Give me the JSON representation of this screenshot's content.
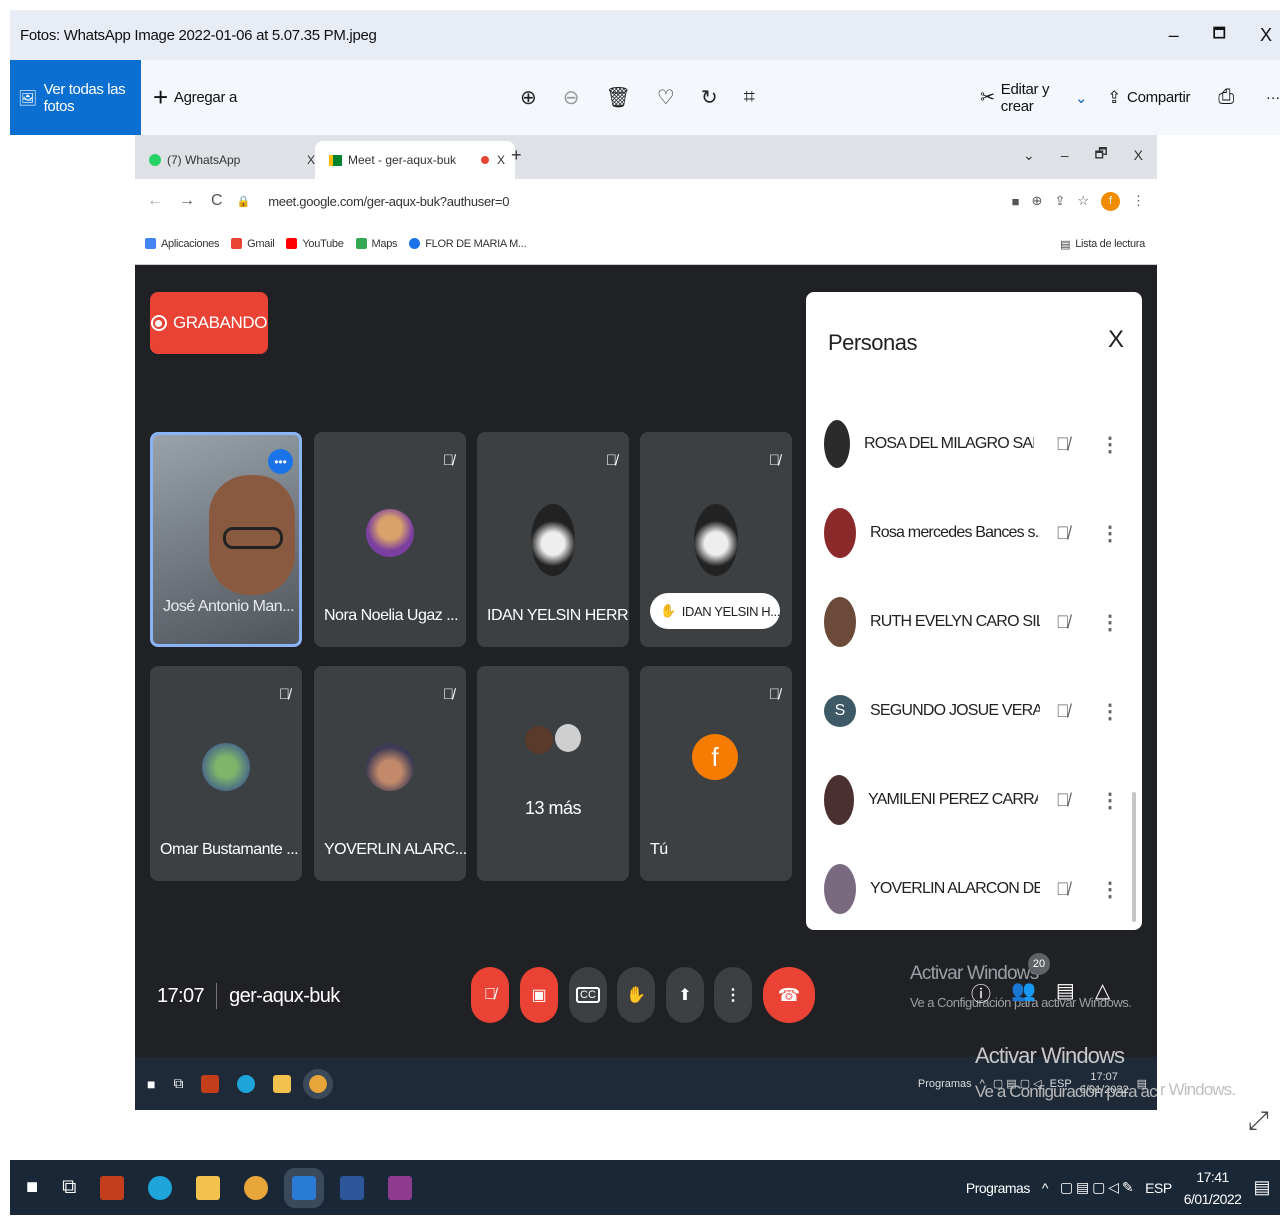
{
  "window": {
    "title": "Fotos: WhatsApp Image 2022-01-06 at 5.07.35 PM.jpeg",
    "controls": [
      "–",
      "🗖",
      "X"
    ]
  },
  "toolbar": {
    "see_all": "Ver todas las fotos",
    "add_to": "Agregar a",
    "edit_create": "Editar y crear",
    "share": "Compartir",
    "more": "···"
  },
  "browser": {
    "tabs": [
      {
        "label": "(7) WhatsApp",
        "close": "X"
      },
      {
        "label": "Meet - ger-aqux-buk",
        "close": "X"
      }
    ],
    "new_tab": "+",
    "url": "meet.google.com/ger-aqux-buk?authuser=0",
    "profile_initial": "f",
    "bookmarks": [
      {
        "label": "Aplicaciones",
        "color": "#4285f4"
      },
      {
        "label": "Gmail",
        "color": "#ea4335"
      },
      {
        "label": "YouTube",
        "color": "#ff0000"
      },
      {
        "label": "Maps",
        "color": "#34a853"
      },
      {
        "label": "FLOR DE MARIA M...",
        "color": "#1a73e8"
      }
    ],
    "reading_list": "Lista de lectura"
  },
  "meet": {
    "recording": "GRABANDO",
    "tiles": [
      {
        "name": "José Antonio Man..."
      },
      {
        "name": "Nora Noelia Ugaz ..."
      },
      {
        "name": "IDAN YELSIN HERR..."
      },
      {
        "name": "IDAN YELSIN H..."
      },
      {
        "name": "Omar Bustamante ..."
      },
      {
        "name": "YOVERLIN ALARC..."
      },
      {
        "name": "13 más"
      },
      {
        "name": "Tú",
        "initial": "f"
      }
    ],
    "time": "17:07",
    "code": "ger-aqux-buk",
    "participants_count": "20",
    "activate_title": "Activar Windows",
    "activate_sub": "Ve a Configuración para activar Windows."
  },
  "people_panel": {
    "title": "Personas",
    "close": "X",
    "people": [
      {
        "name": "ROSA DEL MILAGRO SAN...",
        "avatar_color": "#2b2b2b"
      },
      {
        "name": "Rosa mercedes Bances s...",
        "avatar_color": "#8a2a2a"
      },
      {
        "name": "RUTH EVELYN CARO SILVA",
        "avatar_color": "#6b4a3a"
      },
      {
        "name": "SEGUNDO JOSUE VERA I...",
        "avatar_color": "#3d5a66",
        "initial": "S"
      },
      {
        "name": "YAMILENI PEREZ CARRAS...",
        "avatar_color": "#4a3030"
      },
      {
        "name": "YOVERLIN ALARCON DEL...",
        "avatar_color": "#7a6a80"
      }
    ]
  },
  "inner_taskbar": {
    "programs": "Programas",
    "lang": "ESP",
    "time": "17:07",
    "date": "6/01/2022"
  },
  "taskbar": {
    "programs": "Programas",
    "lang": "ESP",
    "time": "17:41",
    "date": "6/01/2022"
  }
}
